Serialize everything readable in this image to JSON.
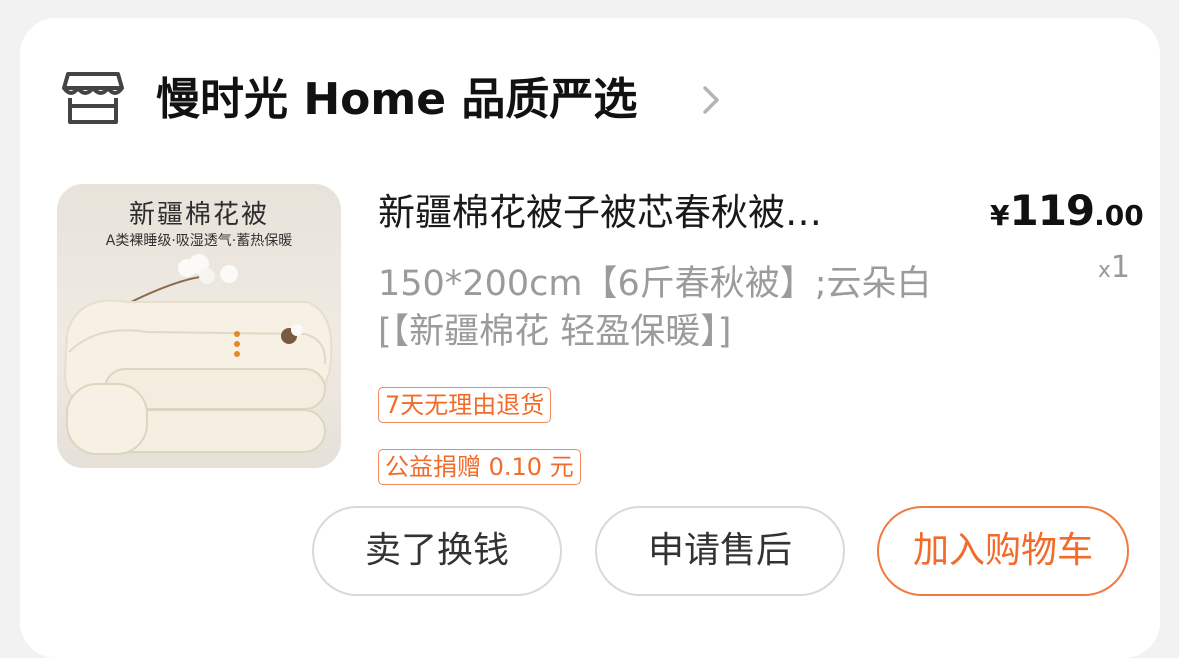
{
  "store": {
    "icon": "store-icon",
    "name": "慢时光 Home 品质严选",
    "chevron": "chevron-right-icon"
  },
  "product": {
    "image": {
      "title": "新疆棉花被",
      "subtitle": "A类裸睡级·吸湿透气·蓄热保暖"
    },
    "title": "新疆棉花被子被芯春秋被…",
    "spec": "150*200cm【6斤春秋被】;云朵白[【新疆棉花 轻盈保暖】]",
    "price_currency": "¥",
    "price_integer": "119",
    "price_decimal": ".00",
    "quantity_prefix": "x",
    "quantity": "1",
    "tags": [
      "7天无理由退货",
      "公益捐赠 0.10 元"
    ]
  },
  "actions": {
    "sell": "卖了换钱",
    "after_sale": "申请售后",
    "add_to_cart": "加入购物车"
  },
  "colors": {
    "accent": "#f26b2a",
    "border": "#d9d9d9"
  }
}
